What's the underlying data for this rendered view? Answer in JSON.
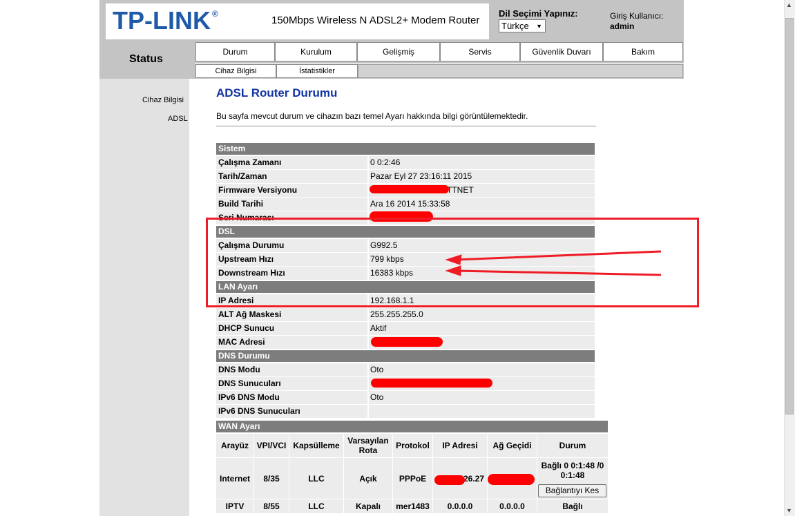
{
  "header": {
    "logo": "TP-LINK",
    "logo_reg": "®",
    "model": "150Mbps Wireless N ADSL2+ Modem Router",
    "language_label": "Dil Seçimi Yapınız:",
    "language_value": "Türkçe",
    "user_label": "Giriş Kullanıcı:",
    "user_name": "admin"
  },
  "status_label": "Status",
  "nav": [
    "Durum",
    "Kurulum",
    "Gelişmiş",
    "Servis",
    "Güvenlik Duvarı",
    "Bakım"
  ],
  "subnav": [
    "Cihaz Bilgisi",
    "İstatistikler"
  ],
  "sidebar": [
    "Cihaz Bilgisi",
    "ADSL"
  ],
  "content": {
    "title": "ADSL Router Durumu",
    "description": "Bu sayfa mevcut durum ve cihazın bazı temel Ayarı hakkında bilgi görüntülemektedir."
  },
  "sections": {
    "sistem": "Sistem",
    "dsl": "DSL",
    "lan": "LAN Ayarı",
    "dns": "DNS Durumu",
    "wan": "WAN Ayarı"
  },
  "sistem_rows": [
    {
      "k": "Çalışma Zamanı",
      "v": "0 0:2:46"
    },
    {
      "k": "Tarih/Zaman",
      "v": "Pazar Eyl 27 23:16:11 2015"
    },
    {
      "k": "Firmware Versiyonu",
      "v": "TTNET"
    },
    {
      "k": "Build Tarihi",
      "v": "Ara 16 2014 15:33:58"
    },
    {
      "k": "Seri Numarası",
      "v": ""
    }
  ],
  "dsl_rows": [
    {
      "k": "Çalışma Durumu",
      "v": "G992.5"
    },
    {
      "k": "Upstream Hızı",
      "v": "799 kbps"
    },
    {
      "k": "Downstream Hızı",
      "v": "16383 kbps"
    }
  ],
  "lan_rows": [
    {
      "k": "IP Adresi",
      "v": "192.168.1.1"
    },
    {
      "k": "ALT Ağ Maskesi",
      "v": "255.255.255.0"
    },
    {
      "k": "DHCP Sunucu",
      "v": "Aktif"
    },
    {
      "k": "MAC Adresi",
      "v": ""
    }
  ],
  "dns_rows": [
    {
      "k": "DNS Modu",
      "v": "Oto"
    },
    {
      "k": "DNS Sunucuları",
      "v": ""
    },
    {
      "k": "IPv6 DNS Modu",
      "v": "Oto"
    },
    {
      "k": "IPv6 DNS Sunucuları",
      "v": ""
    }
  ],
  "wan": {
    "headers": [
      "Arayüz",
      "VPI/VCI",
      "Kapsülleme",
      "Varsayılan Rota",
      "Protokol",
      "IP Adresi",
      "Ağ Geçidi",
      "Durum"
    ],
    "rows": [
      {
        "arayuz": "Internet",
        "vpi": "8/35",
        "kaps": "LLC",
        "rota": "Açık",
        "protokol": "PPPoE",
        "ip": "26.27",
        "gw": "",
        "durum": "Bağlı 0 0:1:48 /0 0:1:48",
        "button": "Bağlantıyı Kes"
      },
      {
        "arayuz": "IPTV",
        "vpi": "8/55",
        "kaps": "LLC",
        "rota": "Kapalı",
        "protokol": "mer1483",
        "ip": "0.0.0.0",
        "gw": "0.0.0.0",
        "durum": "Bağlı"
      }
    ]
  },
  "colors": {
    "logo": "#1f5aa8",
    "title": "#1033a3",
    "section_header": "#7d7d7d",
    "annotation": "#ee1c25"
  }
}
